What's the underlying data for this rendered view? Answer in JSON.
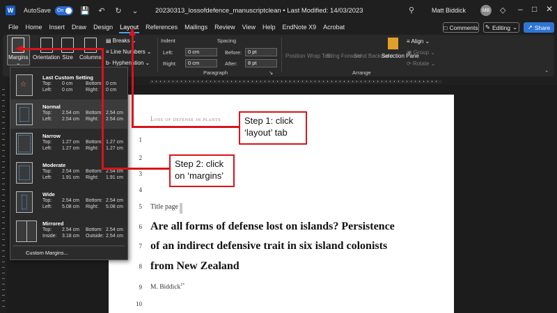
{
  "titlebar": {
    "app_icon": "W",
    "autosave_label": "AutoSave",
    "autosave_state": "On",
    "doc_title": "20230313_lossofdefence_manuscriptclean • Last Modified: 14/03/2023",
    "username": "Matt Biddick",
    "avatar_initials": "MB",
    "icons": [
      "save-icon",
      "undo-icon",
      "redo-icon",
      "search-icon",
      "diamond-icon",
      "minimize-icon",
      "restore-icon",
      "close-icon"
    ]
  },
  "menu": {
    "tabs": [
      "File",
      "Home",
      "Insert",
      "Draw",
      "Design",
      "Layout",
      "References",
      "Mailings",
      "Review",
      "View",
      "Help",
      "EndNote X9",
      "Acrobat"
    ],
    "active_tab": "Layout",
    "comments_label": "Comments",
    "editing_label": "Editing",
    "share_label": "Share"
  },
  "ribbon": {
    "page_setup": {
      "margins": "Margins",
      "orientation": "Orientation",
      "size": "Size",
      "columns": "Columns",
      "breaks": "Breaks",
      "line_numbers": "Line Numbers",
      "hyphenation": "Hyphenation"
    },
    "indent": {
      "title": "Indent",
      "left_label": "Left:",
      "left_value": "0 cm",
      "right_label": "Right:",
      "right_value": "0 cm"
    },
    "spacing": {
      "title": "Spacing",
      "before_label": "Before:",
      "before_value": "0 pt",
      "after_label": "After:",
      "after_value": "8 pt"
    },
    "paragraph_group": "Paragraph",
    "arrange": {
      "position": "Position",
      "wrap_text": "Wrap Text",
      "bring_forward": "Bring Forward",
      "send_backward": "Send Backward",
      "selection_pane": "Selection Pane",
      "align": "Align",
      "group": "Group",
      "rotate": "Rotate",
      "group_label": "Arrange"
    }
  },
  "margins_menu": {
    "items": [
      {
        "name": "Last Custom Setting",
        "top": "0 cm",
        "bottom": "0 cm",
        "left": "0 cm",
        "right": "0 cm",
        "left_label": "Left:",
        "right_label": "Right:"
      },
      {
        "name": "Normal",
        "top": "2.54 cm",
        "bottom": "2.54 cm",
        "left": "2.54 cm",
        "right": "2.54 cm",
        "left_label": "Left:",
        "right_label": "Right:"
      },
      {
        "name": "Narrow",
        "top": "1.27 cm",
        "bottom": "1.27 cm",
        "left": "1.27 cm",
        "right": "1.27 cm",
        "left_label": "Left:",
        "right_label": "Right:"
      },
      {
        "name": "Moderate",
        "top": "2.54 cm",
        "bottom": "2.54 cm",
        "left": "1.91 cm",
        "right": "1.91 cm",
        "left_label": "Left:",
        "right_label": "Right:"
      },
      {
        "name": "Wide",
        "top": "2.54 cm",
        "bottom": "2.54 cm",
        "left": "5.08 cm",
        "right": "5.08 cm",
        "left_label": "Left:",
        "right_label": "Right:"
      },
      {
        "name": "Mirrored",
        "top": "2.54 cm",
        "bottom": "2.54 cm",
        "left": "3.18 cm",
        "right": "2.54 cm",
        "left_label": "Inside:",
        "right_label": "Outside:"
      }
    ],
    "top_label": "Top:",
    "bottom_label": "Bottom:",
    "custom": "Custom Margins..."
  },
  "document": {
    "header": "Loss of defense in plants",
    "line_numbers": [
      "1",
      "2",
      "3",
      "4",
      "5",
      "6",
      "7",
      "8",
      "9",
      "10"
    ],
    "title_page_label": "Title page",
    "heading_lines": [
      "Are all forms of defense lost on islands? Persistence",
      "of an indirect defensive trait in six island colonists",
      "from New Zealand"
    ],
    "author": "M. Biddick",
    "author_sup": "1*"
  },
  "annotations": {
    "step1_line1": "Step 1: click",
    "step1_line2": "‘layout’ tab",
    "step2_line1": "Step 2: click",
    "step2_line2": "on ‘margins’",
    "color": "#d8141a"
  }
}
